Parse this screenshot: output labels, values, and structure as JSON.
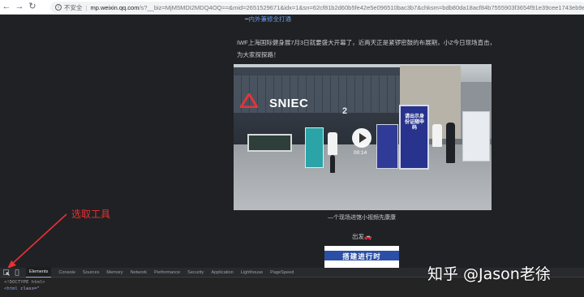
{
  "browser": {
    "security_label": "不安全",
    "url_host": "mp.weixin.qq.com",
    "url_path": "/s?__biz=MjM5MDI2MDQ4OQ==&mid=2651529671&idx=1&sn=62cf81b2d60b5fe42e5e096510bac3b7&chksm=bdb80da18acf84b7555903f3654f91e39cee1743eb9e4ec93a1"
  },
  "article": {
    "link_text": "━内外兼修全打通",
    "paragraph": "IWF上海国际健身展7月3日就要盛大开幕了，近两天正是紧锣密鼓的布展期，小Z今日现场直击，为大家探探路！",
    "video": {
      "logo_text": "SNIEC",
      "hall_text": "2",
      "banner_text": "请出示身份证随申码",
      "duration": "00:14"
    },
    "video_caption": "—个现场进馆小视频先康康",
    "depart_text": "出发🚗",
    "preview_text": "搭建进行时"
  },
  "annotation": {
    "label": "选取工具",
    "color": "#e83232"
  },
  "devtools": {
    "tabs": [
      "Elements",
      "Console",
      "Sources",
      "Memory",
      "Network",
      "Performance",
      "Security",
      "Application",
      "Lighthouse",
      "PageSpeed"
    ],
    "active_tab": "Elements",
    "doctype_line": "<!DOCTYPE html>",
    "html_tag": "<html",
    "html_attr": "class=\""
  },
  "watermark": "知乎 @Jason老徐"
}
